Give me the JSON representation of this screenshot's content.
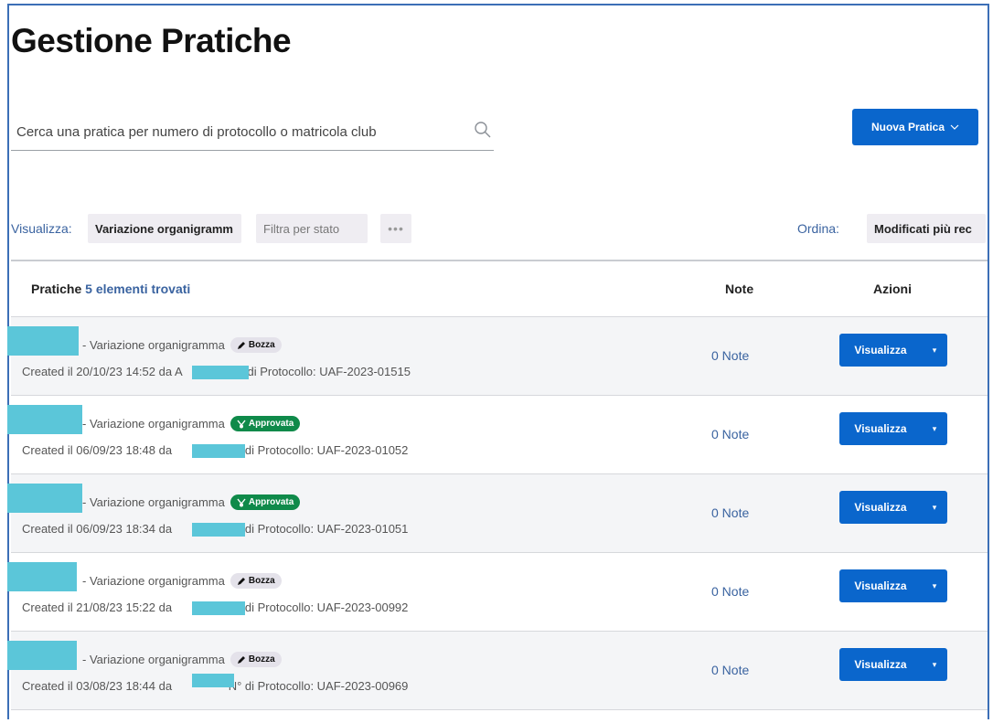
{
  "page": {
    "title": "Gestione Pratiche"
  },
  "search": {
    "placeholder": "Cerca una pratica per numero di protocollo o matricola club",
    "value": ""
  },
  "toolbar": {
    "new_label": "Nuova Pratica"
  },
  "filters": {
    "view_label": "Visualizza:",
    "view_value": "Variazione organigramm",
    "state_placeholder": "Filtra per stato",
    "more_label": "•••",
    "sort_label": "Ordina:",
    "sort_value": "Modificati più rec"
  },
  "table": {
    "col_pratiche": "Pratiche",
    "count_label": "5 elementi trovati",
    "col_note": "Note",
    "col_azioni": "Azioni",
    "rows": [
      {
        "type": "- Variazione organigramma",
        "status": "Bozza",
        "created_prefix": "Created il 20/10/23 14:52 da",
        "created_partial": "A",
        "protocol_text": "° di Protocollo: UAF-2023-01515",
        "notes": "0 Note",
        "action": "Visualizza"
      },
      {
        "type": "- Variazione organigramma",
        "status": "Approvata",
        "created_prefix": "Created il 06/09/23 18:48 da",
        "created_partial": "",
        "protocol_text": "N° di Protocollo: UAF-2023-01052",
        "notes": "0 Note",
        "action": "Visualizza"
      },
      {
        "type": "- Variazione organigramma",
        "status": "Approvata",
        "created_prefix": "Created il 06/09/23 18:34 da",
        "created_partial": "",
        "protocol_text": "N° di Protocollo: UAF-2023-01051",
        "notes": "0 Note",
        "action": "Visualizza"
      },
      {
        "type": "- Variazione organigramma",
        "status": "Bozza",
        "created_prefix": "Created il 21/08/23 15:22 da",
        "created_partial": "",
        "protocol_text": "N° di Protocollo: UAF-2023-00992",
        "notes": "0 Note",
        "action": "Visualizza"
      },
      {
        "type": "- Variazione organigramma",
        "status": "Bozza",
        "created_prefix": "Created il 03/08/23 18:44 da",
        "created_partial": "",
        "protocol_text": "N° di Protocollo: UAF-2023-00969",
        "notes": "0 Note",
        "action": "Visualizza"
      }
    ]
  },
  "colors": {
    "primary": "#0a66cc",
    "approved": "#0f8a4a",
    "draft_badge": "#e4e2ea",
    "redaction": "#5bc6d9"
  }
}
